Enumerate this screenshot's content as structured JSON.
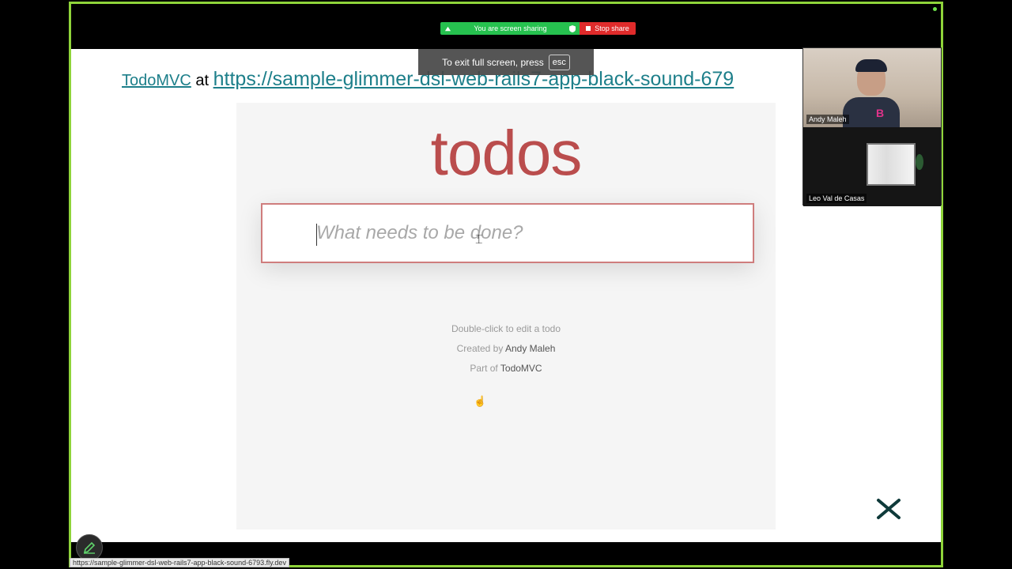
{
  "share_bar": {
    "sharing_text": "You are screen sharing",
    "stop_label": "Stop share",
    "color_green": "#26c14f",
    "color_red": "#e02b2b"
  },
  "fullscreen_toast": {
    "text": "To exit full screen, press",
    "key": "esc"
  },
  "slide": {
    "link_text": "TodoMVC",
    "at_text": "at",
    "url_text": "https://sample-glimmer-dsl-web-rails7-app-black-sound-679"
  },
  "todo_app": {
    "title": "todos",
    "input_placeholder": "What needs to be done?",
    "info_edit": "Double-click to edit a todo",
    "info_created_prefix": "Created by",
    "info_created_author": "Andy Maleh",
    "info_part_prefix": "Part of",
    "info_part_link": "TodoMVC",
    "accent_color": "#af2f2f"
  },
  "participants": [
    {
      "name": "Andy Maleh"
    },
    {
      "name": "Leo Val de Casas"
    }
  ],
  "status_bar": {
    "url": "https://sample-glimmer-dsl-web-rails7-app-black-sound-6793.fly.dev"
  }
}
